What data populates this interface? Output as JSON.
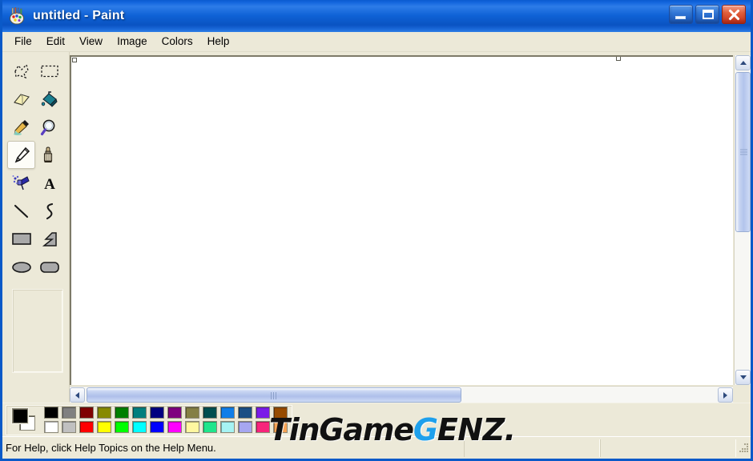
{
  "window": {
    "title_main": "untitled",
    "title_sep": " - ",
    "title_app": "Paint",
    "app_icon": "paint-palette-icon",
    "buttons": {
      "minimize": "minimize-button",
      "maximize": "maximize-button",
      "close": "close-button"
    },
    "titlebar_color": "#0f62d6",
    "frame_color": "#0a59c8"
  },
  "menubar": {
    "items": [
      {
        "label": "File"
      },
      {
        "label": "Edit"
      },
      {
        "label": "View"
      },
      {
        "label": "Image"
      },
      {
        "label": "Colors"
      },
      {
        "label": "Help"
      }
    ]
  },
  "toolbox": {
    "selected_tool": "pencil",
    "tools": [
      {
        "name": "free-form-select",
        "label": "Free-Form Select",
        "selected": false
      },
      {
        "name": "select",
        "label": "Select",
        "selected": false
      },
      {
        "name": "eraser",
        "label": "Eraser/Color Eraser",
        "selected": false
      },
      {
        "name": "fill-with-color",
        "label": "Fill With Color",
        "selected": false
      },
      {
        "name": "pick-color",
        "label": "Pick Color",
        "selected": false
      },
      {
        "name": "magnifier",
        "label": "Magnifier",
        "selected": false
      },
      {
        "name": "pencil",
        "label": "Pencil",
        "selected": true
      },
      {
        "name": "brush",
        "label": "Brush",
        "selected": false
      },
      {
        "name": "airbrush",
        "label": "Airbrush",
        "selected": false
      },
      {
        "name": "text",
        "label": "Text",
        "selected": false
      },
      {
        "name": "line",
        "label": "Line",
        "selected": false
      },
      {
        "name": "curve",
        "label": "Curve",
        "selected": false
      },
      {
        "name": "rectangle",
        "label": "Rectangle",
        "selected": false
      },
      {
        "name": "polygon",
        "label": "Polygon",
        "selected": false
      },
      {
        "name": "ellipse",
        "label": "Ellipse",
        "selected": false
      },
      {
        "name": "rounded-rectangle",
        "label": "Rounded Rectangle",
        "selected": false
      }
    ],
    "tool_options_empty": true
  },
  "canvas": {
    "background": "#ffffff",
    "handles": [
      "top-left-resize-handle",
      "top-middle-resize-handle"
    ]
  },
  "scrollbars": {
    "vertical": {
      "up": "scroll-up-arrow",
      "down": "scroll-down-arrow",
      "thumb": "vertical-scroll-thumb"
    },
    "horizontal": {
      "left": "scroll-left-arrow",
      "right": "scroll-right-arrow",
      "thumb": "horizontal-scroll-thumb"
    }
  },
  "palette": {
    "foreground": "#000000",
    "background": "#ffffff",
    "row1": [
      "#000000",
      "#808080",
      "#7f0000",
      "#878a00",
      "#007f00",
      "#007f7e",
      "#000080",
      "#7f007f",
      "#847f44",
      "#004f4f",
      "#0f7ee8",
      "#1b4f84",
      "#7a1be8",
      "#964b00"
    ],
    "row2": [
      "#ffffff",
      "#c0c0c0",
      "#ff0000",
      "#ffff00",
      "#00ff00",
      "#00ffff",
      "#0000ff",
      "#ff00ff",
      "#fff7a0",
      "#1fe58c",
      "#a6f3f3",
      "#a6a6f0",
      "#f7247b",
      "#f6a355"
    ]
  },
  "watermark": {
    "part_a": "TinGame",
    "part_g": "G",
    "part_b": "ENZ.",
    "color_g": "#1ea0ec",
    "color_text": "#111111"
  },
  "statusbar": {
    "message": "For Help, click Help Topics on the Help Menu.",
    "panel_left": "",
    "panel_right": "",
    "grip": "resize-grip"
  }
}
